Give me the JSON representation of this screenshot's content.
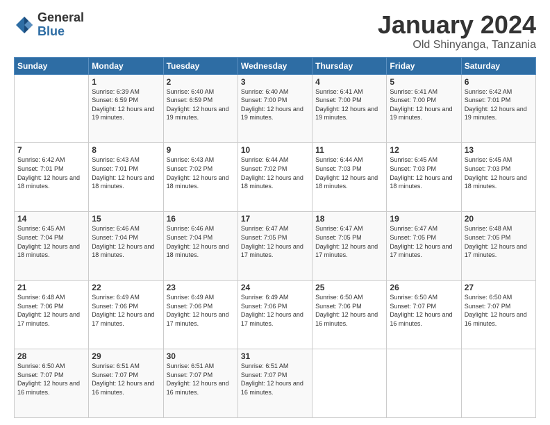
{
  "logo": {
    "general": "General",
    "blue": "Blue"
  },
  "title": "January 2024",
  "subtitle": "Old Shinyanga, Tanzania",
  "header_days": [
    "Sunday",
    "Monday",
    "Tuesday",
    "Wednesday",
    "Thursday",
    "Friday",
    "Saturday"
  ],
  "weeks": [
    [
      {
        "day": "",
        "sunrise": "",
        "sunset": "",
        "daylight": ""
      },
      {
        "day": "1",
        "sunrise": "Sunrise: 6:39 AM",
        "sunset": "Sunset: 6:59 PM",
        "daylight": "Daylight: 12 hours and 19 minutes."
      },
      {
        "day": "2",
        "sunrise": "Sunrise: 6:40 AM",
        "sunset": "Sunset: 6:59 PM",
        "daylight": "Daylight: 12 hours and 19 minutes."
      },
      {
        "day": "3",
        "sunrise": "Sunrise: 6:40 AM",
        "sunset": "Sunset: 7:00 PM",
        "daylight": "Daylight: 12 hours and 19 minutes."
      },
      {
        "day": "4",
        "sunrise": "Sunrise: 6:41 AM",
        "sunset": "Sunset: 7:00 PM",
        "daylight": "Daylight: 12 hours and 19 minutes."
      },
      {
        "day": "5",
        "sunrise": "Sunrise: 6:41 AM",
        "sunset": "Sunset: 7:00 PM",
        "daylight": "Daylight: 12 hours and 19 minutes."
      },
      {
        "day": "6",
        "sunrise": "Sunrise: 6:42 AM",
        "sunset": "Sunset: 7:01 PM",
        "daylight": "Daylight: 12 hours and 19 minutes."
      }
    ],
    [
      {
        "day": "7",
        "sunrise": "Sunrise: 6:42 AM",
        "sunset": "Sunset: 7:01 PM",
        "daylight": "Daylight: 12 hours and 18 minutes."
      },
      {
        "day": "8",
        "sunrise": "Sunrise: 6:43 AM",
        "sunset": "Sunset: 7:01 PM",
        "daylight": "Daylight: 12 hours and 18 minutes."
      },
      {
        "day": "9",
        "sunrise": "Sunrise: 6:43 AM",
        "sunset": "Sunset: 7:02 PM",
        "daylight": "Daylight: 12 hours and 18 minutes."
      },
      {
        "day": "10",
        "sunrise": "Sunrise: 6:44 AM",
        "sunset": "Sunset: 7:02 PM",
        "daylight": "Daylight: 12 hours and 18 minutes."
      },
      {
        "day": "11",
        "sunrise": "Sunrise: 6:44 AM",
        "sunset": "Sunset: 7:03 PM",
        "daylight": "Daylight: 12 hours and 18 minutes."
      },
      {
        "day": "12",
        "sunrise": "Sunrise: 6:45 AM",
        "sunset": "Sunset: 7:03 PM",
        "daylight": "Daylight: 12 hours and 18 minutes."
      },
      {
        "day": "13",
        "sunrise": "Sunrise: 6:45 AM",
        "sunset": "Sunset: 7:03 PM",
        "daylight": "Daylight: 12 hours and 18 minutes."
      }
    ],
    [
      {
        "day": "14",
        "sunrise": "Sunrise: 6:45 AM",
        "sunset": "Sunset: 7:04 PM",
        "daylight": "Daylight: 12 hours and 18 minutes."
      },
      {
        "day": "15",
        "sunrise": "Sunrise: 6:46 AM",
        "sunset": "Sunset: 7:04 PM",
        "daylight": "Daylight: 12 hours and 18 minutes."
      },
      {
        "day": "16",
        "sunrise": "Sunrise: 6:46 AM",
        "sunset": "Sunset: 7:04 PM",
        "daylight": "Daylight: 12 hours and 18 minutes."
      },
      {
        "day": "17",
        "sunrise": "Sunrise: 6:47 AM",
        "sunset": "Sunset: 7:05 PM",
        "daylight": "Daylight: 12 hours and 17 minutes."
      },
      {
        "day": "18",
        "sunrise": "Sunrise: 6:47 AM",
        "sunset": "Sunset: 7:05 PM",
        "daylight": "Daylight: 12 hours and 17 minutes."
      },
      {
        "day": "19",
        "sunrise": "Sunrise: 6:47 AM",
        "sunset": "Sunset: 7:05 PM",
        "daylight": "Daylight: 12 hours and 17 minutes."
      },
      {
        "day": "20",
        "sunrise": "Sunrise: 6:48 AM",
        "sunset": "Sunset: 7:05 PM",
        "daylight": "Daylight: 12 hours and 17 minutes."
      }
    ],
    [
      {
        "day": "21",
        "sunrise": "Sunrise: 6:48 AM",
        "sunset": "Sunset: 7:06 PM",
        "daylight": "Daylight: 12 hours and 17 minutes."
      },
      {
        "day": "22",
        "sunrise": "Sunrise: 6:49 AM",
        "sunset": "Sunset: 7:06 PM",
        "daylight": "Daylight: 12 hours and 17 minutes."
      },
      {
        "day": "23",
        "sunrise": "Sunrise: 6:49 AM",
        "sunset": "Sunset: 7:06 PM",
        "daylight": "Daylight: 12 hours and 17 minutes."
      },
      {
        "day": "24",
        "sunrise": "Sunrise: 6:49 AM",
        "sunset": "Sunset: 7:06 PM",
        "daylight": "Daylight: 12 hours and 17 minutes."
      },
      {
        "day": "25",
        "sunrise": "Sunrise: 6:50 AM",
        "sunset": "Sunset: 7:06 PM",
        "daylight": "Daylight: 12 hours and 16 minutes."
      },
      {
        "day": "26",
        "sunrise": "Sunrise: 6:50 AM",
        "sunset": "Sunset: 7:07 PM",
        "daylight": "Daylight: 12 hours and 16 minutes."
      },
      {
        "day": "27",
        "sunrise": "Sunrise: 6:50 AM",
        "sunset": "Sunset: 7:07 PM",
        "daylight": "Daylight: 12 hours and 16 minutes."
      }
    ],
    [
      {
        "day": "28",
        "sunrise": "Sunrise: 6:50 AM",
        "sunset": "Sunset: 7:07 PM",
        "daylight": "Daylight: 12 hours and 16 minutes."
      },
      {
        "day": "29",
        "sunrise": "Sunrise: 6:51 AM",
        "sunset": "Sunset: 7:07 PM",
        "daylight": "Daylight: 12 hours and 16 minutes."
      },
      {
        "day": "30",
        "sunrise": "Sunrise: 6:51 AM",
        "sunset": "Sunset: 7:07 PM",
        "daylight": "Daylight: 12 hours and 16 minutes."
      },
      {
        "day": "31",
        "sunrise": "Sunrise: 6:51 AM",
        "sunset": "Sunset: 7:07 PM",
        "daylight": "Daylight: 12 hours and 16 minutes."
      },
      {
        "day": "",
        "sunrise": "",
        "sunset": "",
        "daylight": ""
      },
      {
        "day": "",
        "sunrise": "",
        "sunset": "",
        "daylight": ""
      },
      {
        "day": "",
        "sunrise": "",
        "sunset": "",
        "daylight": ""
      }
    ]
  ]
}
